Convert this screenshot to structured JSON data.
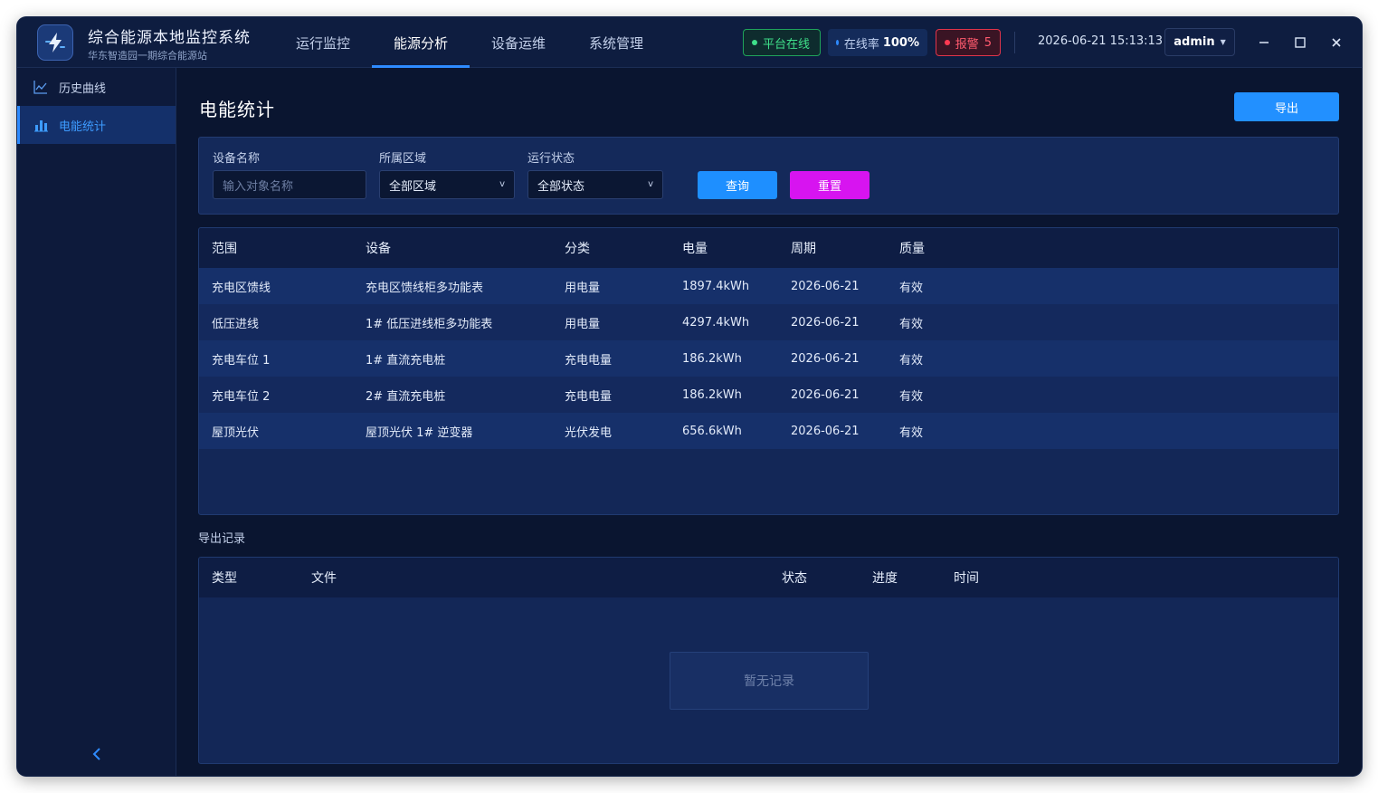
{
  "app": {
    "title": "综合能源本地监控系统",
    "subtitle": "华东智造园一期综合能源站"
  },
  "nav": {
    "items": [
      "运行监控",
      "能源分析",
      "设备运维",
      "系统管理"
    ],
    "active_index": 1
  },
  "status": {
    "platform": "平台在线",
    "online_rate_label": "在线率",
    "online_rate_value": "100%",
    "alarm_label": "报警",
    "alarm_count": "5"
  },
  "clock": "2026-06-21 15:13:13",
  "user": {
    "name": "admin"
  },
  "sidebar": {
    "items": [
      {
        "label": "历史曲线",
        "icon": "line-chart-icon"
      },
      {
        "label": "电能统计",
        "icon": "bar-chart-icon"
      }
    ],
    "active_index": 1
  },
  "page": {
    "title": "电能统计",
    "export_label": "导出"
  },
  "filters": {
    "device_name_label": "设备名称",
    "device_name_placeholder": "输入对象名称",
    "area_label": "所属区域",
    "area_value": "全部区域",
    "status_label": "运行状态",
    "status_value": "全部状态",
    "query_label": "查询",
    "reset_label": "重置"
  },
  "table": {
    "columns": [
      "范围",
      "设备",
      "分类",
      "电量",
      "周期",
      "质量"
    ],
    "rows": [
      [
        "充电区馈线",
        "充电区馈线柜多功能表",
        "用电量",
        "1897.4kWh",
        "2026-06-21",
        "有效"
      ],
      [
        "低压进线",
        "1# 低压进线柜多功能表",
        "用电量",
        "4297.4kWh",
        "2026-06-21",
        "有效"
      ],
      [
        "充电车位 1",
        "1# 直流充电桩",
        "充电电量",
        "186.2kWh",
        "2026-06-21",
        "有效"
      ],
      [
        "充电车位 2",
        "2# 直流充电桩",
        "充电电量",
        "186.2kWh",
        "2026-06-21",
        "有效"
      ],
      [
        "屋顶光伏",
        "屋顶光伏 1# 逆变器",
        "光伏发电",
        "656.6kWh",
        "2026-06-21",
        "有效"
      ]
    ]
  },
  "export_records": {
    "title": "导出记录",
    "columns": [
      "类型",
      "文件",
      "状态",
      "进度",
      "时间"
    ],
    "empty_text": "暂无记录"
  },
  "colors": {
    "accent": "#2e8bff",
    "online": "#3fe08a",
    "alarm": "#ff5a6e",
    "reset_button": "#d714f0"
  }
}
